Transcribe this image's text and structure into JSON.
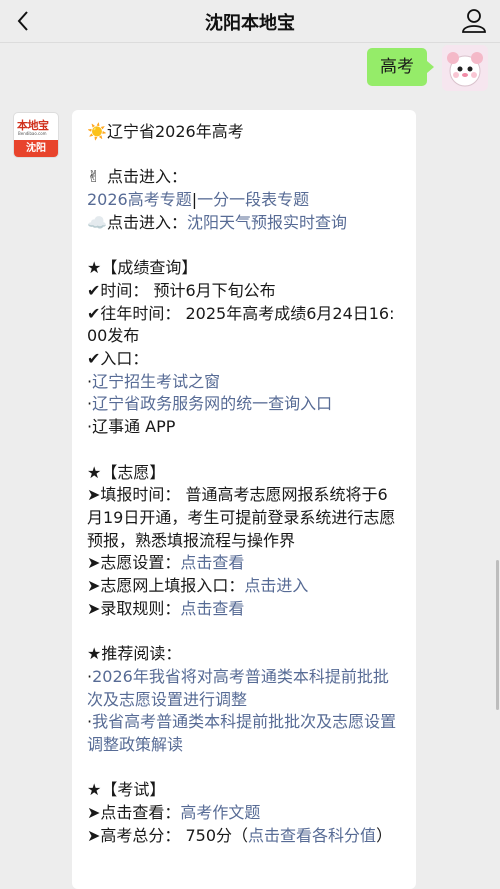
{
  "header": {
    "title": "沈阳本地宝"
  },
  "outgoing": {
    "text": "高考"
  },
  "bot": {
    "brand": "本地宝",
    "brand_sub": "Bendibao.com",
    "city": "沈阳"
  },
  "reply": {
    "title_emoji": "☀️",
    "title": "辽宁省2026年高考",
    "entry_emoji": "✌",
    "entry_label": "点击进入：",
    "entry_link_a": "2026高考专题",
    "entry_sep": "|",
    "entry_link_b": "一分一段表专题",
    "weather_emoji": "☁️",
    "weather_label": "点击进入：",
    "weather_link": "沈阳天气预报实时查询",
    "score_header": "★【成绩查询】",
    "score_time": "✔时间：  预计6月下旬公布",
    "score_past": "✔往年时间：  2025年高考成绩6月24日16:00发布",
    "score_entry": "✔入口：",
    "score_link_1": "辽宁招生考试之窗",
    "score_link_2": "辽宁省政务服务网的统一查询入口",
    "score_app": "辽事通 APP",
    "bullet": "·",
    "wish_header": "★【志愿】",
    "wish_time": "➤填报时间：  普通高考志愿网报系统将于6月19日开通，考生可提前登录系统进行志愿预报，熟悉填报流程与操作界",
    "wish_setting_label": "➤志愿设置：",
    "wish_setting_link": "点击查看",
    "wish_entry_label": "➤志愿网上填报入口：",
    "wish_entry_link": "点击进入",
    "wish_rule_label": "➤录取规则：",
    "wish_rule_link": "点击查看",
    "rec_header": "★推荐阅读：",
    "rec_link_1": "2026年我省将对高考普通类本科提前批批次及志愿设置进行调整",
    "rec_link_2": "我省高考普通类本科提前批批次及志愿设置调整政策解读",
    "exam_header": "★【考试】",
    "exam_view_label": "➤点击查看：",
    "exam_view_link": "高考作文题",
    "exam_total_label": "➤高考总分：  750分（",
    "exam_total_link": "点击查看各科分值",
    "exam_total_close": "）"
  },
  "colors": {
    "link": "#576b95",
    "bubble_out": "#95ec69",
    "bubble_in": "#ffffff",
    "background": "#ededed"
  },
  "icons": [
    "back-chevron-icon",
    "profile-icon",
    "hamster-avatar-icon"
  ]
}
